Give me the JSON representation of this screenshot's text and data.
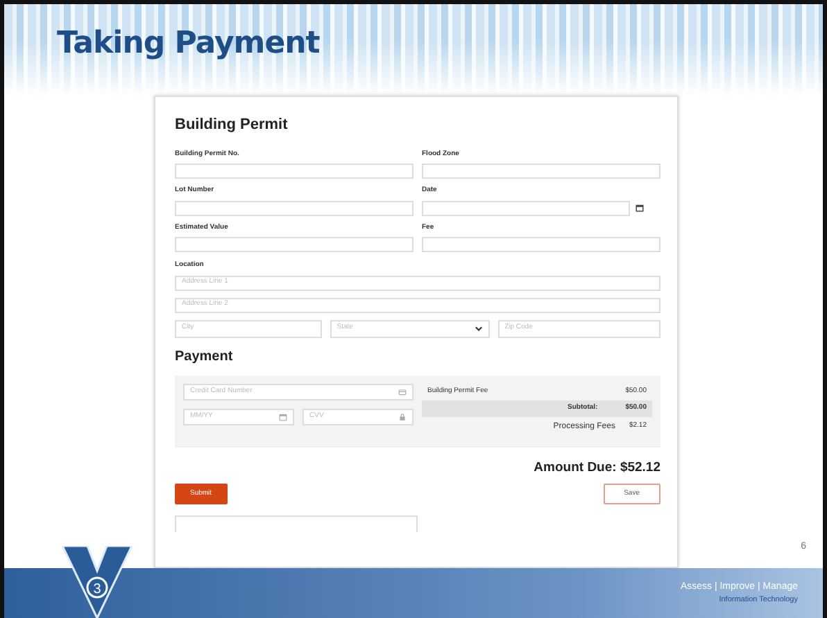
{
  "slide": {
    "title": "Taking Payment",
    "page_number": "6",
    "logo_text": "3",
    "tagline": "Assess | Improve | Manage",
    "subtagline": "Information Technology"
  },
  "form": {
    "title": "Building Permit",
    "fields": [
      {
        "label": "Building Permit No.",
        "kind": "text"
      },
      {
        "label": "Flood Zone",
        "kind": "text"
      },
      {
        "label": "Lot Number",
        "kind": "text"
      },
      {
        "label": "Date",
        "kind": "date"
      },
      {
        "label": "Estimated Value",
        "kind": "text"
      },
      {
        "label": "Fee",
        "kind": "text"
      }
    ],
    "location": {
      "label": "Location",
      "lines": [
        "Address Line 1",
        "Address Line 2"
      ],
      "parts": [
        {
          "placeholder": "City",
          "kind": "text"
        },
        {
          "placeholder": "State",
          "kind": "select"
        },
        {
          "placeholder": "Zip Code",
          "kind": "text"
        }
      ]
    }
  },
  "payment": {
    "title": "Payment",
    "card_fields": [
      {
        "placeholder": "Credit Card Number",
        "kind": "card"
      },
      {
        "placeholder": "MM/YY",
        "kind": "calendar"
      },
      {
        "placeholder": "CVV",
        "kind": "lock"
      }
    ],
    "summary": [
      {
        "label": "Building Permit Fee",
        "value": "$50.00",
        "kind": "item"
      },
      {
        "label": "Subtotal:",
        "value": "$50.00",
        "kind": "subtotal"
      },
      {
        "label": "Processing Fees",
        "value": "$2.12",
        "kind": "item"
      }
    ],
    "amount_due": "Amount Due: $52.12",
    "buttons": [
      {
        "label": "Submit",
        "kind": "primary"
      },
      {
        "label": "Save",
        "kind": "outline"
      }
    ]
  }
}
